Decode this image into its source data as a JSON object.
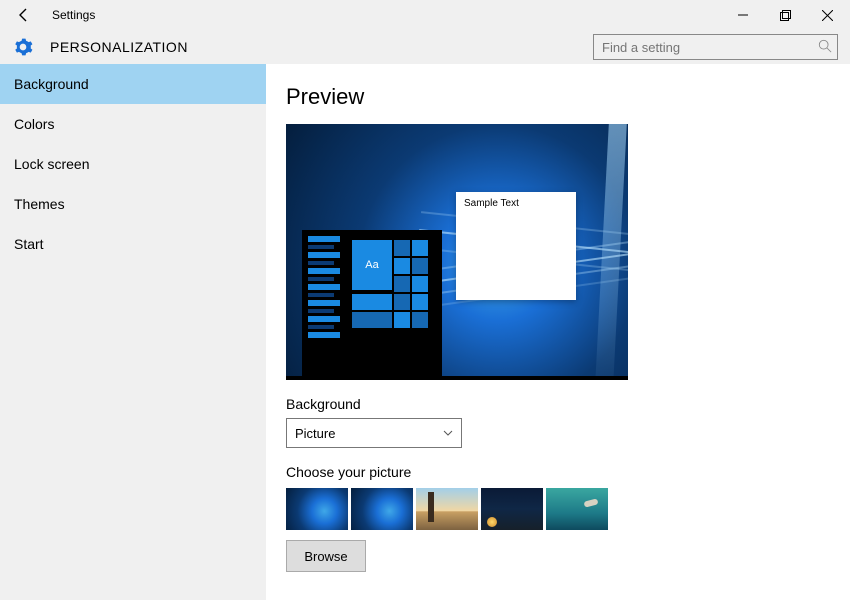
{
  "window": {
    "title": "Settings"
  },
  "header": {
    "category": "PERSONALIZATION"
  },
  "search": {
    "placeholder": "Find a setting"
  },
  "sidebar": {
    "items": [
      {
        "label": "Background",
        "active": true
      },
      {
        "label": "Colors"
      },
      {
        "label": "Lock screen"
      },
      {
        "label": "Themes"
      },
      {
        "label": "Start"
      }
    ]
  },
  "content": {
    "preview_title": "Preview",
    "sample_text": "Sample Text",
    "tile_text": "Aa",
    "background_label": "Background",
    "background_value": "Picture",
    "choose_label": "Choose your picture",
    "browse_label": "Browse"
  }
}
